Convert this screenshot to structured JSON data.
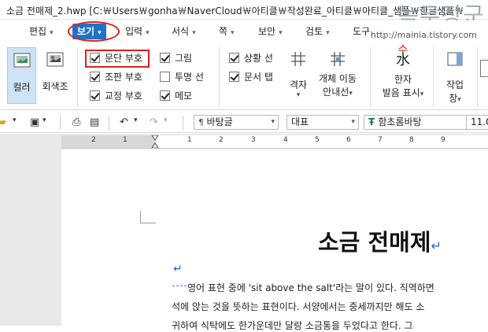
{
  "window": {
    "title": "소금 전매제_2.hwp [C:￦Users￦gonha￦NaverCloud￦아티클￦작성완료_아티클￦아티클_샘플￦한글샘플￦",
    "watermark": "녹두장군",
    "watermark_url": "http://mainia.tistory.com"
  },
  "menu": {
    "items": [
      {
        "label": "편집",
        "arrow": "▾"
      },
      {
        "label": "보기",
        "arrow": "▾"
      },
      {
        "label": "입력",
        "arrow": "▾"
      },
      {
        "label": "서식",
        "arrow": "▾"
      },
      {
        "label": "쪽",
        "arrow": "▾"
      },
      {
        "label": "보안",
        "arrow": "▾"
      },
      {
        "label": "검토",
        "arrow": "▾"
      },
      {
        "label": "도구",
        "arrow": ""
      }
    ]
  },
  "ribbon": {
    "color_label": "컬러",
    "gray_label": "회색조",
    "checkboxes": [
      {
        "label": "문단 부호",
        "checked": true
      },
      {
        "label": "조판 부호",
        "checked": true
      },
      {
        "label": "교정 부호",
        "checked": true
      },
      {
        "label": "그림",
        "checked": true
      },
      {
        "label": "투명 선",
        "checked": false
      },
      {
        "label": "메모",
        "checked": true
      },
      {
        "label": "상황 선",
        "checked": true
      },
      {
        "label": "문서 탭",
        "checked": true
      }
    ],
    "grid_label": "격자",
    "grid_move_label1": "개체 이동",
    "grid_move_label2": "안내선",
    "hanja_top": "수",
    "hanja_label1": "한자",
    "hanja_label2": "발음 표시",
    "window_label1": "작업",
    "window_label2": "창"
  },
  "toolbar": {
    "style_value": "바탕글",
    "lang_value": "대표",
    "font_value": "함초롬바탕",
    "size_value": "11.0"
  },
  "ruler": {
    "numbers": [
      "2",
      "1",
      "1",
      "2",
      "3",
      "4",
      "5",
      "6",
      "7",
      "8",
      "9"
    ]
  },
  "document": {
    "title": "소금 전매제",
    "para_mark": "↵",
    "lines": [
      "영어 표현 중에 'sit above the salt'라는 말이 있다. 직역하면",
      "석에 앉는 것을 뜻하는 표현이다. 서양에서는 중세까지만 해도 소",
      "귀하여 식탁에도 한가운데만 달랑 소금통을 두었다고 한다. 그"
    ]
  }
}
